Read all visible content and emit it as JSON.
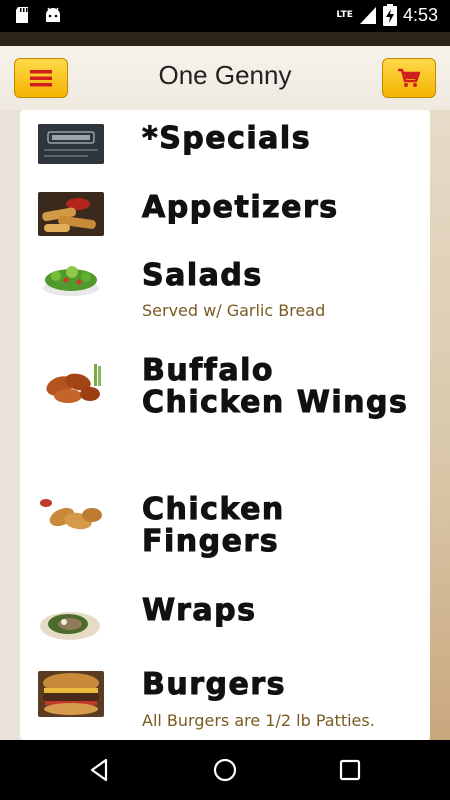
{
  "status_bar": {
    "network": "LTE",
    "time": "4:53",
    "icons": [
      "sd-card-icon",
      "android-icon",
      "signal-icon",
      "battery-charging-icon"
    ]
  },
  "header": {
    "title": "One Genny",
    "menu_icon": "hamburger-menu-icon",
    "cart_icon": "shopping-cart-icon",
    "accent_color": "#f4b400",
    "icon_color": "#d11f1f"
  },
  "menu": {
    "items": [
      {
        "name": "*Specials",
        "description": ""
      },
      {
        "name": "Appetizers",
        "description": ""
      },
      {
        "name": "Salads",
        "description": "Served w/ Garlic Bread"
      },
      {
        "name": "Buffalo Chicken Wings",
        "description": ""
      },
      {
        "name": "Chicken Fingers",
        "description": ""
      },
      {
        "name": "Wraps",
        "description": ""
      },
      {
        "name": "Burgers",
        "description": "All Burgers are 1/2 lb Patties."
      }
    ],
    "description_color": "#7a5a22"
  },
  "nav_bar": {
    "buttons": [
      "back-icon",
      "home-icon",
      "recents-icon"
    ]
  }
}
